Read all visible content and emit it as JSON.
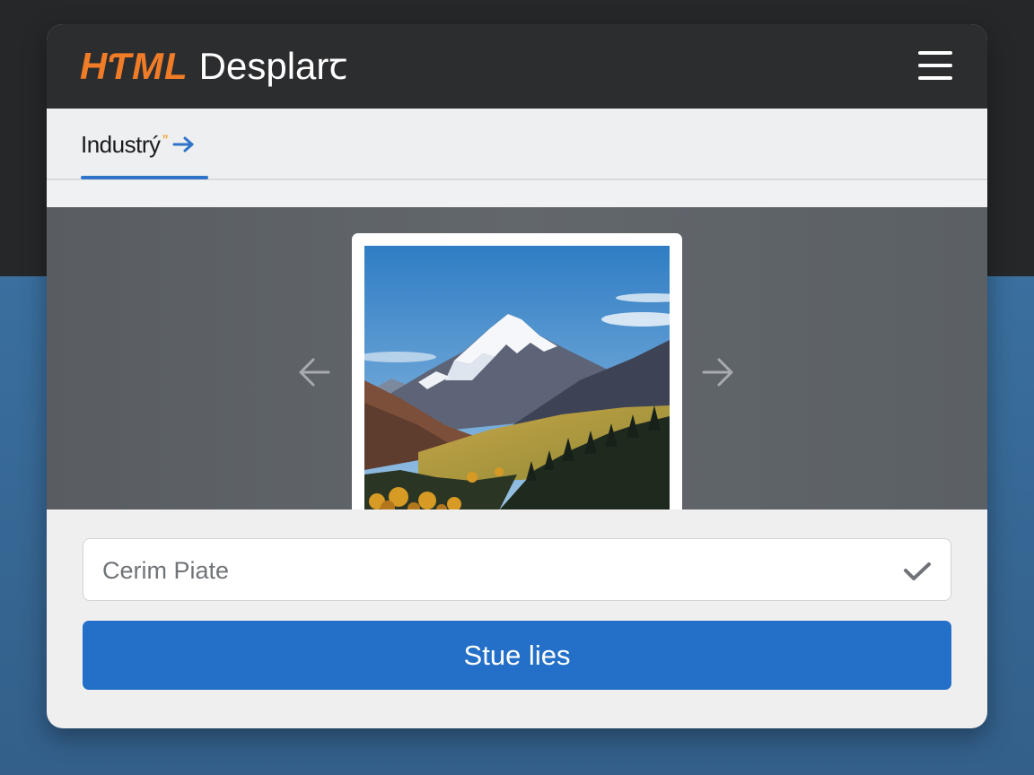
{
  "header": {
    "brand_accent": "HƬML",
    "brand_main": "Desplarꞇ",
    "accent_color": "#f07c28"
  },
  "tabs": [
    {
      "label": "Industrý",
      "badge": "”",
      "icon": "arrow-right-icon",
      "active": true
    }
  ],
  "carousel": {
    "prev_icon": "arrow-left-icon",
    "next_icon": "arrow-right-icon",
    "image": "mountain-landscape"
  },
  "select": {
    "value": "Cerim Piate",
    "icon": "check-icon"
  },
  "primary_button": {
    "label": "Stue lies",
    "color": "#2470c8"
  }
}
